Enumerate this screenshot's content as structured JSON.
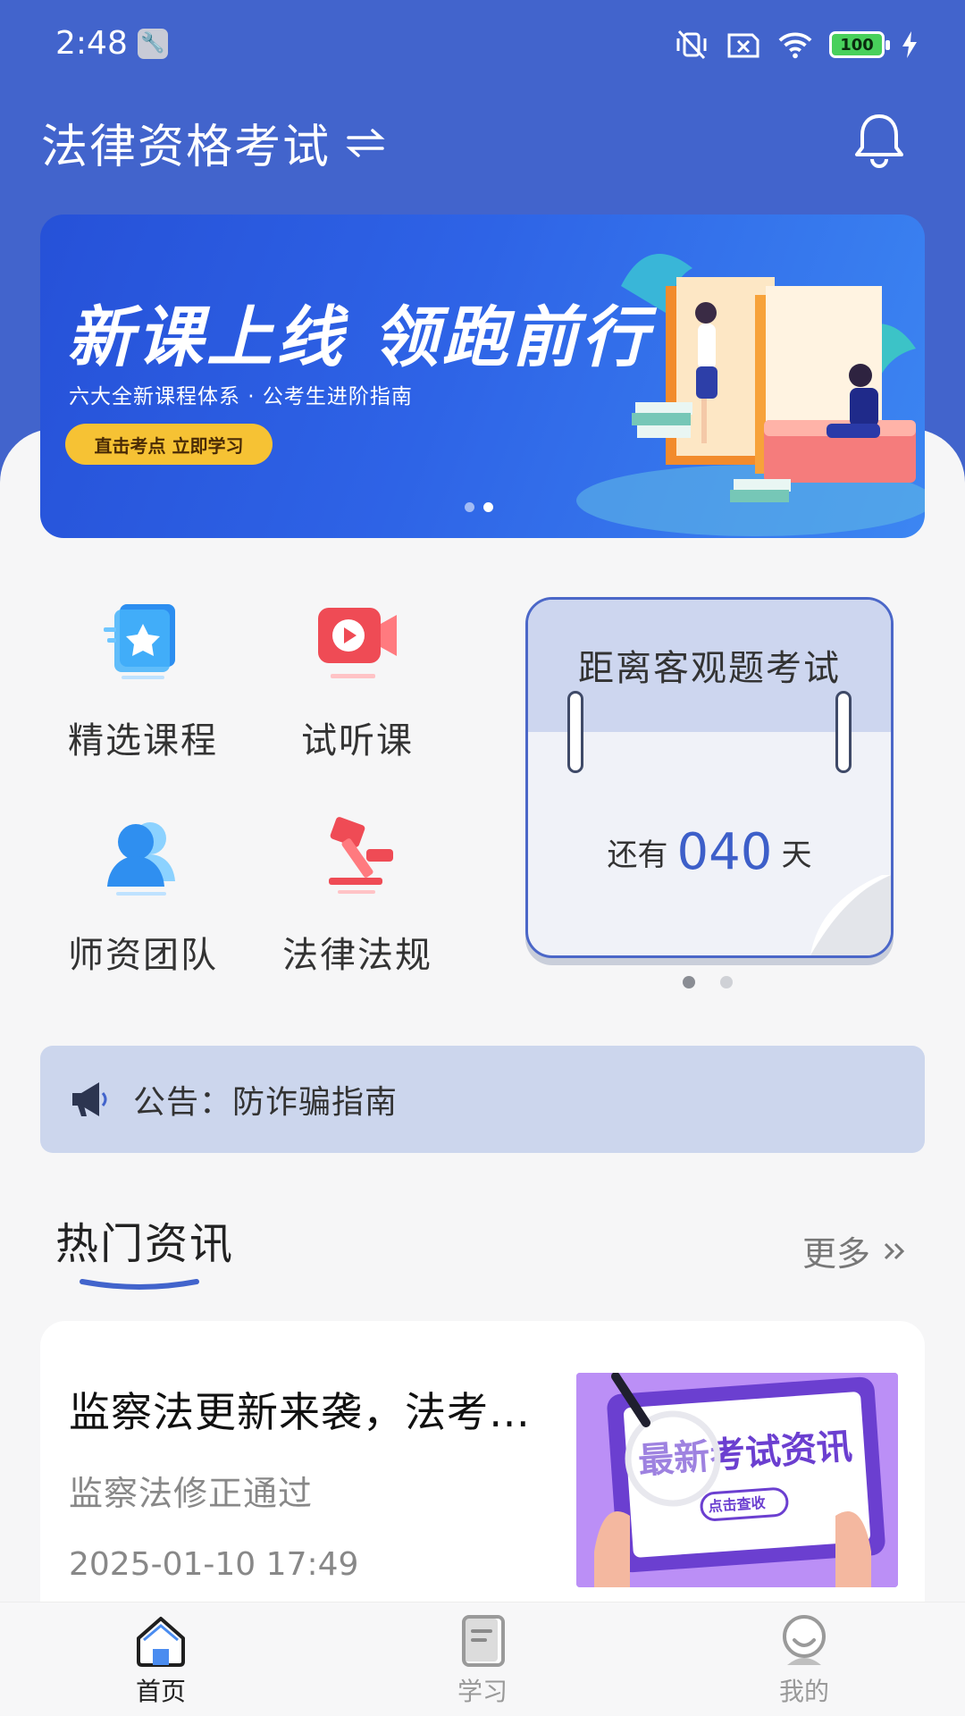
{
  "status_bar": {
    "time": "2:48",
    "battery": "100",
    "icons": [
      "vibrate-off-icon",
      "sim-off-icon",
      "wifi-icon",
      "battery-icon",
      "charging-icon"
    ]
  },
  "header": {
    "title": "法律资格考试",
    "switch_icon": "switch-arrows-icon",
    "bell_icon": "bell-icon"
  },
  "banner": {
    "title": "新课上线 领跑前行",
    "subtitle": "六大全新课程体系 · 公考生进阶指南",
    "button": "直击考点 立即学习",
    "page_count": 2,
    "active_page": 2
  },
  "quick_links": [
    {
      "label": "精选课程",
      "icon": "star-course-icon"
    },
    {
      "label": "试听课",
      "icon": "video-play-icon"
    },
    {
      "label": "师资团队",
      "icon": "teachers-icon"
    },
    {
      "label": "法律法规",
      "icon": "gavel-icon"
    }
  ],
  "countdown": {
    "title": "距离客观题考试",
    "prefix": "还有",
    "days": "040",
    "suffix": "天",
    "page_count": 2,
    "active_page": 1
  },
  "notice": {
    "text": "公告：防诈骗指南",
    "icon": "megaphone-icon"
  },
  "hot_news": {
    "title": "热门资讯",
    "more": "更多",
    "items": [
      {
        "title": "监察法更新来袭，法考…",
        "description": "监察法修正通过",
        "time": "2025-01-10 17:49",
        "thumb_text": "最新考试资讯",
        "thumb_button": "点击查收"
      }
    ]
  },
  "tabbar": {
    "tabs": [
      {
        "label": "首页",
        "icon": "home-icon",
        "active": true
      },
      {
        "label": "学习",
        "icon": "study-icon",
        "active": false
      },
      {
        "label": "我的",
        "icon": "profile-icon",
        "active": false
      }
    ]
  },
  "colors": {
    "primary": "#4264cc",
    "accent_blue": "#3d5fc9",
    "notice_bg": "#ccd6ed",
    "banner_button": "#f6c234",
    "video_red": "#ef4b55"
  }
}
